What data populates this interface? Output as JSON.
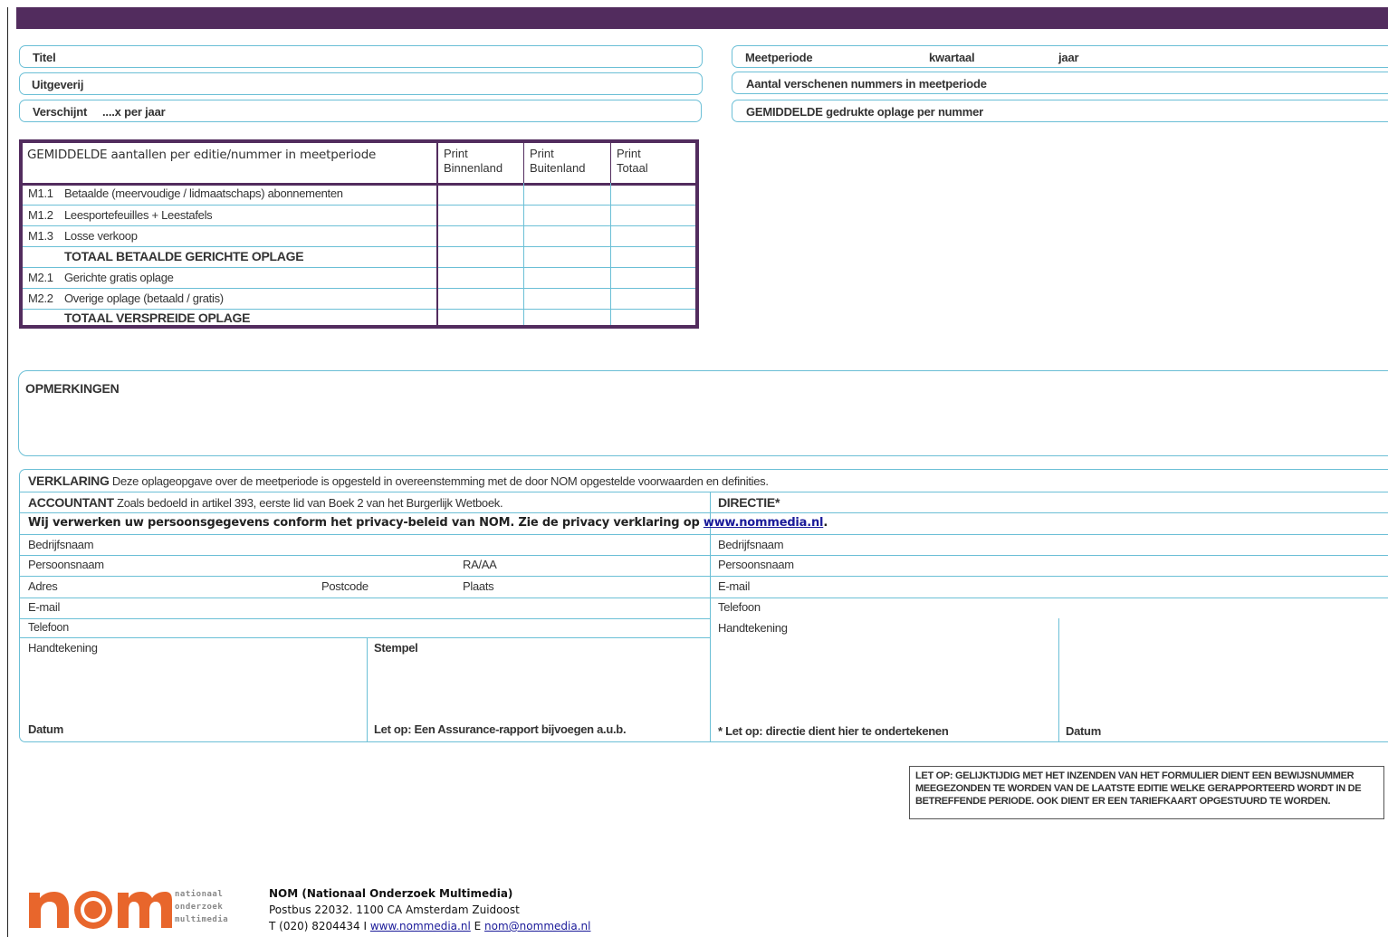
{
  "header": {
    "titel": "Titel",
    "uitgeverij": "Uitgeverij",
    "verschijnt": "Verschijnt",
    "verschijnt_hint": "....x per jaar",
    "meetperiode": "Meetperiode",
    "kwartaal": "kwartaal",
    "jaar": "jaar",
    "aantal_nummers": "Aantal verschenen nummers in meetperiode",
    "gedrukte_oplage": "GEMIDDELDE gedrukte oplage per nummer"
  },
  "table": {
    "heading": "GEMIDDELDE aantallen per editie/nummer in meetperiode",
    "columns": [
      {
        "line1": "Print",
        "line2": "Binnenland"
      },
      {
        "line1": "Print",
        "line2": "Buitenland"
      },
      {
        "line1": "Print",
        "line2": "Totaal"
      }
    ],
    "rows": [
      {
        "code": "M1.1",
        "label": "Betaalde (meervoudige / lidmaatschaps) abonnementen"
      },
      {
        "code": "M1.2",
        "label": "Leesportefeuilles + Leestafels"
      },
      {
        "code": "M1.3",
        "label": "Losse verkoop"
      },
      {
        "code": "",
        "label": "TOTAAL BETAALDE GERICHTE OPLAGE"
      },
      {
        "code": "M2.1",
        "label": "Gerichte gratis oplage"
      },
      {
        "code": "M2.2",
        "label": "Overige oplage (betaald / gratis)"
      },
      {
        "code": "",
        "label": "TOTAAL VERSPREIDE OPLAGE"
      }
    ]
  },
  "opmerkingen": "OPMERKINGEN",
  "declaration": {
    "verklaring_title": "VERKLARING",
    "verklaring_text": "Deze oplageopgave over de meetperiode is opgesteld in overeenstemming met de door NOM opgestelde voorwaarden en definities.",
    "accountant_title": "ACCOUNTANT",
    "accountant_text": "Zoals bedoeld in artikel 393, eerste lid van Boek 2 van het Burgerlijk Wetboek.",
    "directie_title": "DIRECTIE*",
    "privacy_text": "Wij verwerken uw persoonsgegevens conform het privacy-beleid van NOM. Zie de privacy verklaring op",
    "privacy_link": "www.nommedia.nl",
    "privacy_end": ".",
    "left": {
      "bedrijfsnaam": "Bedrijfsnaam",
      "persoonsnaam": "Persoonsnaam",
      "raaa": "RA/AA",
      "adres": "Adres",
      "postcode": "Postcode",
      "plaats": "Plaats",
      "email": "E-mail",
      "telefoon": "Telefoon",
      "handtekening": "Handtekening",
      "stempel": "Stempel",
      "datum": "Datum",
      "assurance": "Let op: Een Assurance-rapport bijvoegen a.u.b."
    },
    "right": {
      "bedrijfsnaam": "Bedrijfsnaam",
      "persoonsnaam": "Persoonsnaam",
      "email": "E-mail",
      "telefoon": "Telefoon",
      "handtekening": "Handtekening",
      "directie_note": "* Let op: directie dient hier te ondertekenen",
      "datum": "Datum"
    }
  },
  "notice": "LET OP: GELIJKTIJDIG MET HET INZENDEN VAN HET FORMULIER DIENT EEN BEWIJSNUMMER MEEGEZONDEN TE WORDEN VAN DE LAATSTE EDITIE WELKE GERAPPORTEERD WORDT IN DE BETREFFENDE PERIODE. OOK DIENT ER EEN TARIEFKAART OPGESTUURD TE WORDEN.",
  "footer": {
    "logo_word": "nom",
    "logo_line1": "nationaal",
    "logo_line2": "onderzoek",
    "logo_line3": "multimedia",
    "org_name": "NOM (Nationaal Onderzoek Multimedia)",
    "address": "Postbus 22032. 1100 CA Amsterdam Zuidoost",
    "phone_prefix": "T (020) 8204434  I",
    "website": "www.nommedia.nl",
    "email_prefix": "E",
    "email": "nom@nommedia.nl"
  },
  "colors": {
    "brand_purple": "#522c5e",
    "field_border": "#6bbfd6",
    "logo_orange": "#e8662c"
  }
}
